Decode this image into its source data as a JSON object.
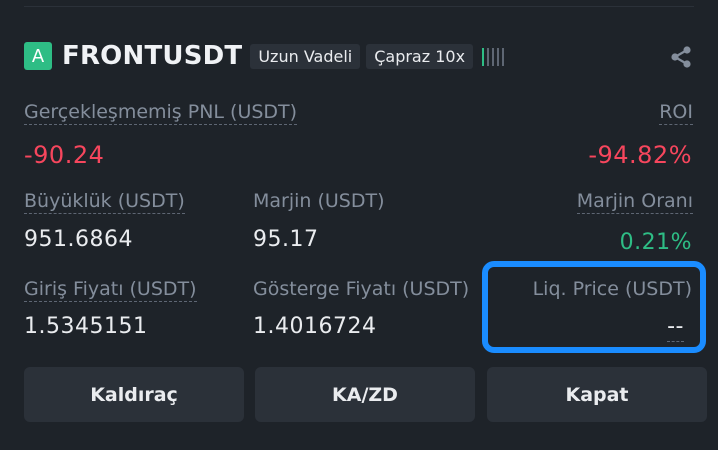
{
  "position": {
    "icon_letter": "A",
    "symbol": "FRONTUSDT",
    "tags": [
      "Uzun Vadeli",
      "Çapraz 10x"
    ],
    "risk_level": 1,
    "risk_bars_total": 5,
    "share_icon": "share-icon"
  },
  "stats": {
    "pnl": {
      "label": "Gerçekleşmemiş PNL (USDT)",
      "value": "-90.24"
    },
    "roi": {
      "label": "ROI",
      "value": "-94.82%"
    },
    "size": {
      "label": "Büyüklük (USDT)",
      "value": "951.6864"
    },
    "margin": {
      "label": "Marjin (USDT)",
      "value": "95.17"
    },
    "margin_ratio": {
      "label": "Marjin Oranı",
      "value": "0.21%"
    },
    "entry_price": {
      "label": "Giriş Fiyatı (USDT)",
      "value": "1.5345151"
    },
    "mark_price": {
      "label": "Gösterge Fiyatı (USDT)",
      "value": "1.4016724"
    },
    "liq_price": {
      "label": "Liq. Price (USDT)",
      "value": "--"
    }
  },
  "actions": {
    "leverage_label": "Kaldıraç",
    "tpsl_label": "KA/ZD",
    "close_label": "Kapat"
  },
  "colors": {
    "background": "#1e2329",
    "loss": "#f6465d",
    "gain": "#2ebd85",
    "highlight": "#1a8cff"
  }
}
